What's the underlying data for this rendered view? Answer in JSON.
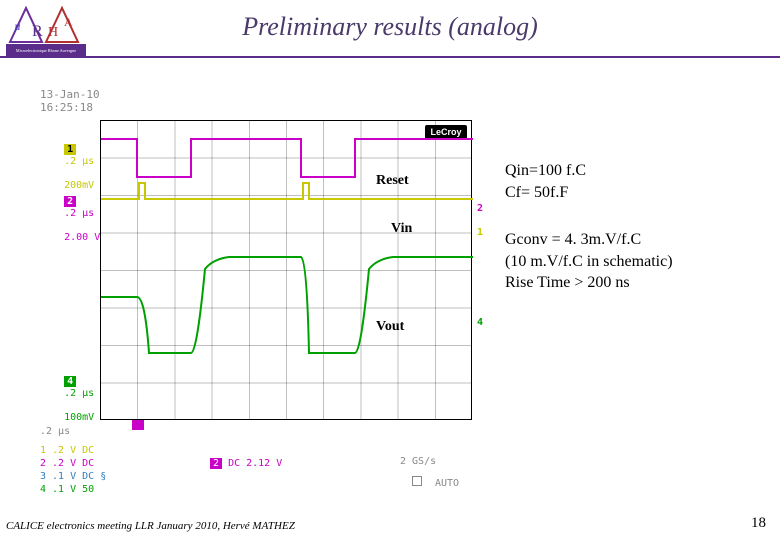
{
  "header": {
    "title": "Preliminary  results (analog)"
  },
  "logo": {
    "name": "urha-logo",
    "subtext": "Microelectronique Rhone Auvergne"
  },
  "scope": {
    "brand": "LeCroy",
    "datetime_line1": "13-Jan-10",
    "datetime_line2": "16:25:18",
    "channels": {
      "ch1": {
        "num": "1",
        "timebase": ".2 µs",
        "scale": "200mV"
      },
      "ch2": {
        "num": "2",
        "timebase": ".2 µs",
        "scale": "2.00 V"
      },
      "ch4": {
        "num": "4",
        "timebase": ".2 µs",
        "scale": "100mV"
      }
    },
    "timebase_label": ".2 µs",
    "summary": "1 .2 V DC\n2 .2 V DC\n3 .1 V DC §\n4 .1 V 50",
    "trigger": "2  DC 2.12 V",
    "sample_rate": "2 GS/s",
    "mode": "AUTO",
    "signal_labels": {
      "reset": "Reset",
      "vin": "Vin",
      "vout": "Vout"
    },
    "right_markers": {
      "ch1": "1",
      "ch2": "2",
      "ch4": "4"
    }
  },
  "annotations": {
    "block1_line1": "Qin=100 f.C",
    "block1_line2": "Cf= 50f.F",
    "block2_line1": "Gconv = 4. 3m.V/f.C",
    "block2_line2": "(10 m.V/f.C in schematic)",
    "block2_line3": "Rise Time > 200 ns"
  },
  "footer": {
    "text": "CALICE electronics  meeting LLR  January 2010, Hervé MATHEZ",
    "page": "18"
  }
}
